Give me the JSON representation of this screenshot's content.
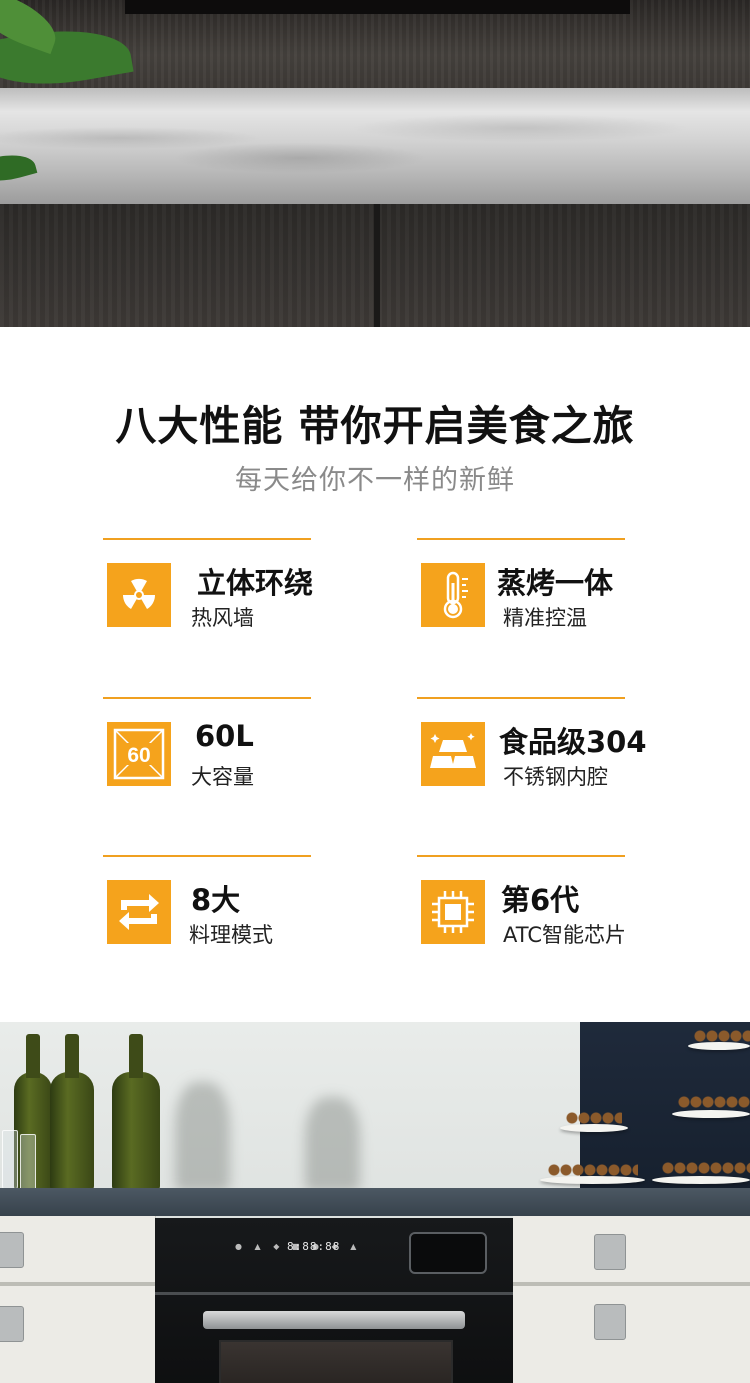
{
  "headline": "八大性能 带你开启美食之旅",
  "subline": "每天给你不一样的新鲜",
  "features": [
    {
      "title": "立体环绕",
      "desc": "热风墙",
      "icon": "radiation-fan-icon"
    },
    {
      "title": "蒸烤一体",
      "desc": "精准控温",
      "icon": "thermometer-icon"
    },
    {
      "title": "60L",
      "desc": "大容量",
      "icon": "capacity-60-icon",
      "icon_text": "60"
    },
    {
      "title": "食品级304",
      "desc": "不锈钢内腔",
      "icon": "gold-bars-icon"
    },
    {
      "title": "8大",
      "desc": "料理模式",
      "icon": "cycle-arrows-icon"
    },
    {
      "title": "第6代",
      "desc": "ATC智能芯片",
      "icon": "chip-icon"
    }
  ],
  "oven_display": "8:88:88",
  "colors": {
    "accent": "#f5a31c",
    "rule": "#f0a020",
    "headline": "#111111",
    "subline": "#8a8a8a"
  }
}
